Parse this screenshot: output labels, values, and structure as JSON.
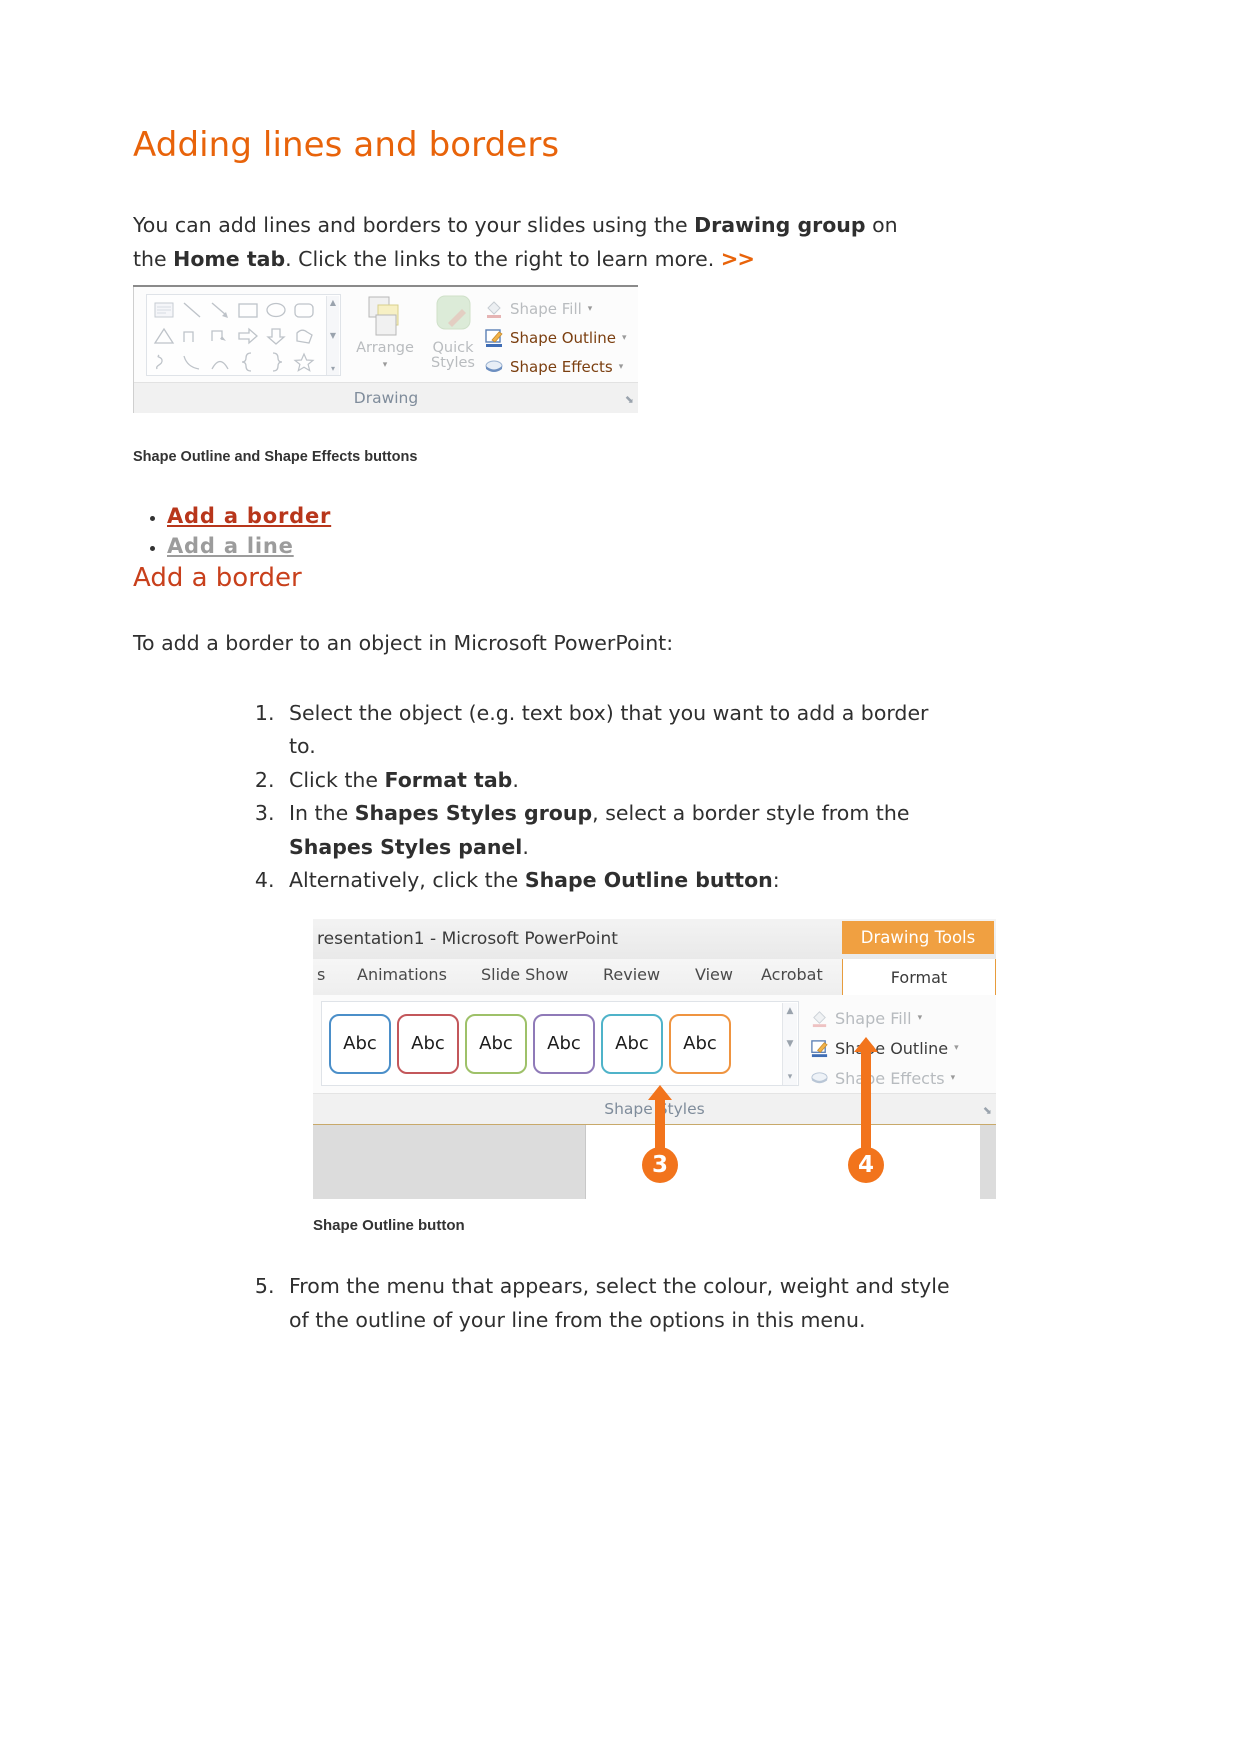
{
  "document": {
    "title": "Adding lines and borders",
    "intro": {
      "part1": "You can add lines and borders to your slides using the ",
      "bold1": "Drawing group",
      "part2": " on the ",
      "bold2": "Home tab",
      "part3": ". Click the links to the right to learn more. ",
      "more_link": ">>"
    },
    "figure1": {
      "caption": "Shape Outline and Shape Effects buttons",
      "ribbon": {
        "group_label": "Drawing",
        "arrange_label": "Arrange",
        "quick_styles_label": "Quick Styles",
        "commands": [
          {
            "label": "Shape Fill",
            "icon": "paint-bucket-icon",
            "state": "disabled",
            "has_caret": true
          },
          {
            "label": "Shape Outline",
            "icon": "pencil-outline-icon",
            "state": "active",
            "has_caret": true
          },
          {
            "label": "Shape Effects",
            "icon": "shape-effects-icon",
            "state": "active",
            "has_caret": true
          }
        ]
      }
    },
    "links": [
      {
        "label": "Add a border",
        "state": "current"
      },
      {
        "label": "Add a line",
        "state": "muted"
      }
    ],
    "section_heading": "Add a border",
    "section_intro": "To add a border to an object in Microsoft PowerPoint:",
    "steps": [
      {
        "num": "1.",
        "segments": [
          {
            "t": "Select the object (e.g. text box) that you want to add a border to.",
            "b": false
          }
        ]
      },
      {
        "num": "2.",
        "segments": [
          {
            "t": "Click the ",
            "b": false
          },
          {
            "t": "Format tab",
            "b": true
          },
          {
            "t": ".",
            "b": false
          }
        ]
      },
      {
        "num": "3.",
        "segments": [
          {
            "t": "In the ",
            "b": false
          },
          {
            "t": "Shapes Styles group",
            "b": true
          },
          {
            "t": ", select a border style from the ",
            "b": false
          },
          {
            "t": "Shapes Styles panel",
            "b": true
          },
          {
            "t": ".",
            "b": false
          }
        ]
      },
      {
        "num": "4.",
        "segments": [
          {
            "t": "Alternatively, click the ",
            "b": false
          },
          {
            "t": "Shape Outline button",
            "b": true
          },
          {
            "t": ":",
            "b": false
          }
        ]
      }
    ],
    "steps_cont": [
      {
        "num": "5.",
        "segments": [
          {
            "t": "From the menu that appears, select the colour, weight and style of the outline of your line from the options in this menu.",
            "b": false
          }
        ]
      }
    ],
    "figure2": {
      "caption": "Shape Outline button",
      "window_title": "resentation1  -  Microsoft PowerPoint",
      "contextual_tab_label": "Drawing Tools",
      "tabs": [
        {
          "label": "s"
        },
        {
          "label": "Animations"
        },
        {
          "label": "Slide Show"
        },
        {
          "label": "Review"
        },
        {
          "label": "View"
        },
        {
          "label": "Acrobat"
        }
      ],
      "active_tab": "Format",
      "group_label": "Shape Styles",
      "style_swatches": [
        {
          "text": "Abc",
          "color": "#4b8fc9"
        },
        {
          "text": "Abc",
          "color": "#c3575b"
        },
        {
          "text": "Abc",
          "color": "#9ec martin"
        },
        {
          "text": "Abc",
          "color": "#8f7ab8"
        },
        {
          "text": "Abc",
          "color": "#4fb3c9"
        },
        {
          "text": "Abc",
          "color": "#ef9440"
        }
      ],
      "swatch_colors": [
        "#4b8fc9",
        "#c3575b",
        "#9ec169",
        "#8f7ab8",
        "#4fb3c9",
        "#ef9440"
      ],
      "commands": [
        {
          "label": "Shape Fill",
          "state": "disabled"
        },
        {
          "label": "Shape Outline",
          "state": "active"
        },
        {
          "label": "Shape Effects",
          "state": "disabled"
        }
      ],
      "callouts": [
        {
          "number": "3"
        },
        {
          "number": "4"
        }
      ]
    },
    "colors": {
      "title_orange": "#E8630A",
      "heading_red": "#C8401C",
      "link_red": "#B8361B",
      "link_muted": "#9c9c9c",
      "callout_orange": "#F2741C",
      "ctx_tab_orange": "#F0A041"
    }
  }
}
